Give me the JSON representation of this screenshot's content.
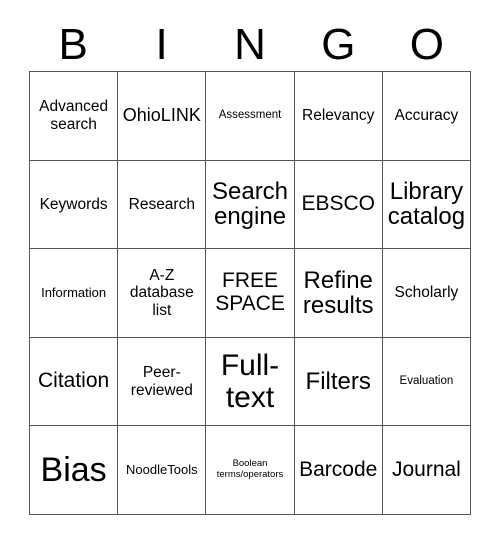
{
  "card": {
    "title": "BINGO",
    "background_color": "#ffffff",
    "text_color": "#000000",
    "border_color": "#555555",
    "columns": 5,
    "rows": 5
  },
  "header": {
    "letters": [
      {
        "label": "B"
      },
      {
        "label": "I"
      },
      {
        "label": "N"
      },
      {
        "label": "G"
      },
      {
        "label": "O"
      }
    ]
  },
  "grid": {
    "rows": [
      {
        "cells": [
          {
            "label": "Advanced search",
            "size": "fs-m",
            "free_space": false
          },
          {
            "label": "OhioLINK",
            "size": "fs-l",
            "free_space": false
          },
          {
            "label": "Assessment",
            "size": "fs-xs",
            "free_space": false
          },
          {
            "label": "Relevancy",
            "size": "fs-m",
            "free_space": false
          },
          {
            "label": "Accuracy",
            "size": "fs-m",
            "free_space": false
          }
        ]
      },
      {
        "cells": [
          {
            "label": "Keywords",
            "size": "fs-m",
            "free_space": false
          },
          {
            "label": "Research",
            "size": "fs-m",
            "free_space": false
          },
          {
            "label": "Search engine",
            "size": "fs-xxl",
            "free_space": false
          },
          {
            "label": "EBSCO",
            "size": "fs-xl",
            "free_space": false
          },
          {
            "label": "Library catalog",
            "size": "fs-xxl",
            "free_space": false
          }
        ]
      },
      {
        "cells": [
          {
            "label": "Information",
            "size": "fs-s",
            "free_space": false
          },
          {
            "label": "A-Z database list",
            "size": "fs-m",
            "free_space": false
          },
          {
            "label": "FREE SPACE",
            "size": "fs-xl",
            "free_space": true
          },
          {
            "label": "Refine results",
            "size": "fs-xxl",
            "free_space": false
          },
          {
            "label": "Scholarly",
            "size": "fs-m",
            "free_space": false
          }
        ]
      },
      {
        "cells": [
          {
            "label": "Citation",
            "size": "fs-xl",
            "free_space": false
          },
          {
            "label": "Peer-reviewed",
            "size": "fs-m",
            "free_space": false
          },
          {
            "label": "Full-text",
            "size": "fs-3xl",
            "free_space": false
          },
          {
            "label": "Filters",
            "size": "fs-xxl",
            "free_space": false
          },
          {
            "label": "Evaluation",
            "size": "fs-xs",
            "free_space": false
          }
        ]
      },
      {
        "cells": [
          {
            "label": "Bias",
            "size": "fs-4xl",
            "free_space": false
          },
          {
            "label": "NoodleTools",
            "size": "fs-s",
            "free_space": false
          },
          {
            "label": "Boolean terms/operators",
            "size": "fs-xxs",
            "free_space": false
          },
          {
            "label": "Barcode",
            "size": "fs-xl",
            "free_space": false
          },
          {
            "label": "Journal",
            "size": "fs-xl",
            "free_space": false
          }
        ]
      }
    ]
  }
}
